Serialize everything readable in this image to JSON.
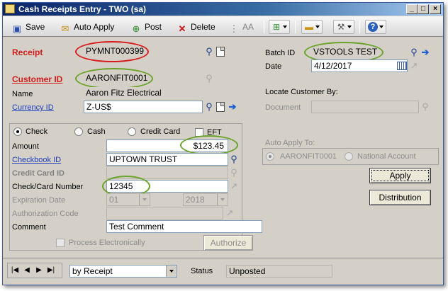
{
  "window": {
    "title": "Cash Receipts Entry  -  TWO (sa)"
  },
  "toolbar": {
    "save": "Save",
    "auto_apply": "Auto Apply",
    "post": "Post",
    "delete": "Delete",
    "aa": "AA"
  },
  "header": {
    "receipt_label": "Receipt",
    "receipt_value": "PYMNT000399",
    "customer_id_label": "Customer ID",
    "customer_id_value": "AARONFIT0001",
    "name_label": "Name",
    "name_value": "Aaron Fitz Electrical",
    "currency_id_label": "Currency ID",
    "currency_id_value": "Z-US$",
    "batch_id_label": "Batch ID",
    "batch_id_value": "VSTOOLS TEST",
    "date_label": "Date",
    "date_value": "4/12/2017",
    "locate_label": "Locate Customer By:",
    "document_label": "Document",
    "document_value": ""
  },
  "payment": {
    "check": "Check",
    "cash": "Cash",
    "credit_card": "Credit Card",
    "eft": "EFT",
    "amount_label": "Amount",
    "amount_value": "$123.45",
    "checkbook_id_label": "Checkbook ID",
    "checkbook_id_value": "UPTOWN TRUST",
    "credit_card_id_label": "Credit Card ID",
    "check_card_number_label": "Check/Card Number",
    "check_card_number_value": "12345",
    "expiration_date_label": "Expiration Date",
    "expiration_month": "01",
    "expiration_year": "2018",
    "authorization_code_label": "Authorization Code",
    "comment_label": "Comment",
    "comment_value": "Test Comment",
    "process_electronically": "Process Electronically",
    "authorize": "Authorize"
  },
  "auto_apply": {
    "label": "Auto Apply To:",
    "option_customer": "AARONFIT0001",
    "option_national": "National Account",
    "apply_button": "Apply",
    "distribution_button": "Distribution"
  },
  "status_bar": {
    "sort_value": "by Receipt",
    "status_label": "Status",
    "status_value": "Unposted"
  }
}
